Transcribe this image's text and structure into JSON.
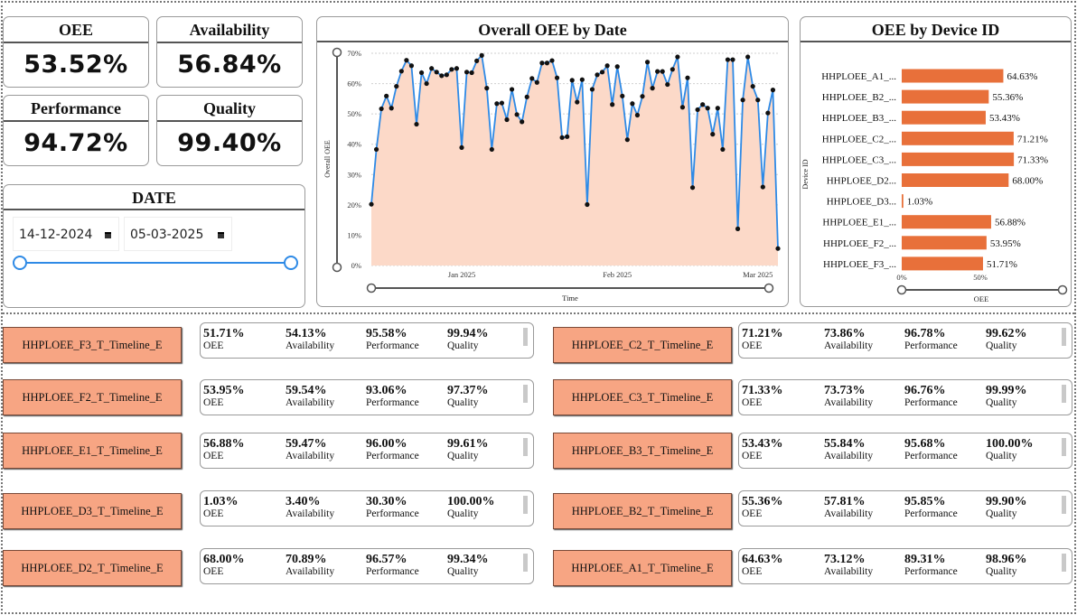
{
  "kpis": {
    "oee": {
      "label": "OEE",
      "value": "53.52%"
    },
    "availability": {
      "label": "Availability",
      "value": "56.84%"
    },
    "performance": {
      "label": "Performance",
      "value": "94.72%"
    },
    "quality": {
      "label": "Quality",
      "value": "99.40%"
    }
  },
  "date_filter": {
    "title": "DATE",
    "start": "14-12-2024",
    "end": "05-03-2025",
    "range_fraction": [
      0.0,
      1.0
    ]
  },
  "chart_data": [
    {
      "type": "area",
      "title": "Overall OEE by Date",
      "xlabel": "Time",
      "ylabel": "Overall OEE",
      "x_tick_labels": [
        "Jan 2025",
        "Feb 2025",
        "Mar 2025"
      ],
      "y_tick_labels": [
        "0%",
        "10%",
        "20%",
        "30%",
        "40%",
        "50%",
        "60%",
        "70%"
      ],
      "ylim": [
        0,
        70
      ],
      "x_start": "2024-12-14",
      "x_end": "2025-03-05",
      "grid": true,
      "line_color": "#2e8ae6",
      "fill_color": "#fcd9c8",
      "series": [
        {
          "x": [
            "2024-12-14",
            "2024-12-15",
            "2024-12-16",
            "2024-12-17",
            "2024-12-18",
            "2024-12-19",
            "2024-12-20",
            "2024-12-21",
            "2024-12-22",
            "2024-12-23",
            "2024-12-24",
            "2024-12-25",
            "2024-12-26",
            "2024-12-27",
            "2024-12-28",
            "2024-12-29",
            "2024-12-30",
            "2024-12-31",
            "2025-01-01",
            "2025-01-02",
            "2025-01-03",
            "2025-01-04",
            "2025-01-05",
            "2025-01-06",
            "2025-01-07",
            "2025-01-08",
            "2025-01-09",
            "2025-01-10",
            "2025-01-11",
            "2025-01-12",
            "2025-01-13",
            "2025-01-14",
            "2025-01-15",
            "2025-01-16",
            "2025-01-17",
            "2025-01-18",
            "2025-01-19",
            "2025-01-20",
            "2025-01-21",
            "2025-01-22",
            "2025-01-23",
            "2025-01-24",
            "2025-01-25",
            "2025-01-26",
            "2025-01-27",
            "2025-01-28",
            "2025-01-29",
            "2025-01-30",
            "2025-01-31",
            "2025-02-01",
            "2025-02-02",
            "2025-02-03",
            "2025-02-04",
            "2025-02-05",
            "2025-02-06",
            "2025-02-07",
            "2025-02-08",
            "2025-02-09",
            "2025-02-10",
            "2025-02-11",
            "2025-02-12",
            "2025-02-13",
            "2025-02-14",
            "2025-02-15",
            "2025-02-16",
            "2025-02-17",
            "2025-02-18",
            "2025-02-19",
            "2025-02-20",
            "2025-02-21",
            "2025-02-22",
            "2025-02-23",
            "2025-02-24",
            "2025-02-25",
            "2025-02-26",
            "2025-02-27",
            "2025-02-28",
            "2025-03-01",
            "2025-03-02",
            "2025-03-03",
            "2025-03-04",
            "2025-03-05"
          ],
          "values": [
            20.2,
            38.3,
            51.7,
            55.9,
            51.9,
            59.1,
            64.1,
            67.7,
            65.9,
            46.6,
            63.6,
            60.0,
            65.0,
            63.8,
            62.6,
            62.9,
            64.7,
            65.0,
            38.9,
            63.8,
            63.6,
            67.5,
            69.3,
            58.5,
            38.3,
            53.4,
            53.6,
            48.1,
            58.1,
            49.8,
            47.4,
            55.6,
            61.7,
            60.4,
            66.8,
            66.8,
            67.6,
            61.9,
            42.2,
            42.5,
            61.1,
            53.9,
            61.3,
            20.1,
            58.1,
            62.9,
            63.8,
            65.9,
            53.1,
            65.6,
            55.9,
            41.5,
            53.4,
            49.6,
            55.8,
            67.1,
            58.5,
            64.0,
            64.0,
            59.7,
            64.7,
            68.8,
            52.2,
            61.9,
            25.7,
            51.4,
            53.1,
            51.9,
            43.3,
            51.9,
            38.3,
            67.9,
            67.9,
            12.1,
            54.6,
            68.8,
            59.1,
            54.6,
            25.9,
            50.3,
            57.9,
            5.6
          ]
        }
      ]
    },
    {
      "type": "bar",
      "orientation": "horizontal",
      "title": "OEE by Device ID",
      "xlabel": "OEE",
      "ylabel": "Device ID",
      "x_tick_labels": [
        "0%",
        "50%"
      ],
      "xlim": [
        0,
        100
      ],
      "bar_color": "#e8703a",
      "categories": [
        "HHPLOEE_A1_...",
        "HHPLOEE_B2_...",
        "HHPLOEE_B3_...",
        "HHPLOEE_C2_...",
        "HHPLOEE_C3_...",
        "HHPLOEE_D2...",
        "HHPLOEE_D3...",
        "HHPLOEE_E1_...",
        "HHPLOEE_F2_...",
        "HHPLOEE_F3_..."
      ],
      "values": [
        64.63,
        55.36,
        53.43,
        71.21,
        71.33,
        68.0,
        1.03,
        56.88,
        53.95,
        51.71
      ],
      "data_labels": [
        "64.63%",
        "55.36%",
        "53.43%",
        "71.21%",
        "71.33%",
        "68.00%",
        "1.03%",
        "56.88%",
        "53.95%",
        "51.71%"
      ]
    }
  ],
  "metric_labels": {
    "oee": "OEE",
    "availability": "Availability",
    "performance": "Performance",
    "quality": "Quality"
  },
  "devices": [
    {
      "name": "HHPLOEE_F3_T_Timeline_E",
      "oee": "51.71%",
      "availability": "54.13%",
      "performance": "95.58%",
      "quality": "99.94%"
    },
    {
      "name": "HHPLOEE_F2_T_Timeline_E",
      "oee": "53.95%",
      "availability": "59.54%",
      "performance": "93.06%",
      "quality": "97.37%"
    },
    {
      "name": "HHPLOEE_E1_T_Timeline_E",
      "oee": "56.88%",
      "availability": "59.47%",
      "performance": "96.00%",
      "quality": "99.61%"
    },
    {
      "name": "HHPLOEE_D3_T_Timeline_E",
      "oee": "1.03%",
      "availability": "3.40%",
      "performance": "30.30%",
      "quality": "100.00%"
    },
    {
      "name": "HHPLOEE_D2_T_Timeline_E",
      "oee": "68.00%",
      "availability": "70.89%",
      "performance": "96.57%",
      "quality": "99.34%"
    },
    {
      "name": "HHPLOEE_C2_T_Timeline_E",
      "oee": "71.21%",
      "availability": "73.86%",
      "performance": "96.78%",
      "quality": "99.62%"
    },
    {
      "name": "HHPLOEE_C3_T_Timeline_E",
      "oee": "71.33%",
      "availability": "73.73%",
      "performance": "96.76%",
      "quality": "99.99%"
    },
    {
      "name": "HHPLOEE_B3_T_Timeline_E",
      "oee": "53.43%",
      "availability": "55.84%",
      "performance": "95.68%",
      "quality": "100.00%"
    },
    {
      "name": "HHPLOEE_B2_T_Timeline_E",
      "oee": "55.36%",
      "availability": "57.81%",
      "performance": "95.85%",
      "quality": "99.90%"
    },
    {
      "name": "HHPLOEE_A1_T_Timeline_E",
      "oee": "64.63%",
      "availability": "73.12%",
      "performance": "89.31%",
      "quality": "98.96%"
    }
  ]
}
